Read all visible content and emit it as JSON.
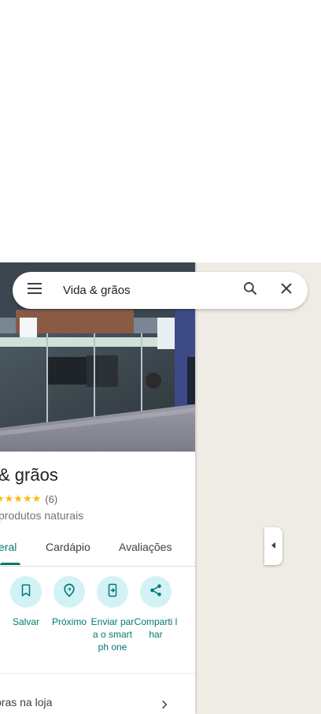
{
  "search": {
    "query": "Vida & grãos",
    "menu_icon": "menu-icon",
    "search_icon": "search-icon",
    "close_icon": "close-icon"
  },
  "place": {
    "name": "& grãos",
    "stars": "★★★★★",
    "rating_count": "(6)",
    "category": "produtos naturais"
  },
  "tabs": [
    {
      "label": "eral",
      "active": true
    },
    {
      "label": "Cardápio",
      "active": false
    },
    {
      "label": "Avaliações",
      "active": false
    }
  ],
  "actions": [
    {
      "label": "Salvar",
      "icon": "bookmark-icon"
    },
    {
      "label": "Próximo",
      "icon": "nearby-icon"
    },
    {
      "label": "Enviar para o smartph one",
      "icon": "send-to-phone-icon"
    },
    {
      "label": "Comparti lhar",
      "icon": "share-icon"
    }
  ],
  "info_row": {
    "text": "pras na loja",
    "icon": "chevron-right-icon"
  },
  "colors": {
    "accent": "#01796f",
    "action_bg": "#d2f2f5",
    "star": "#fbbc04"
  }
}
